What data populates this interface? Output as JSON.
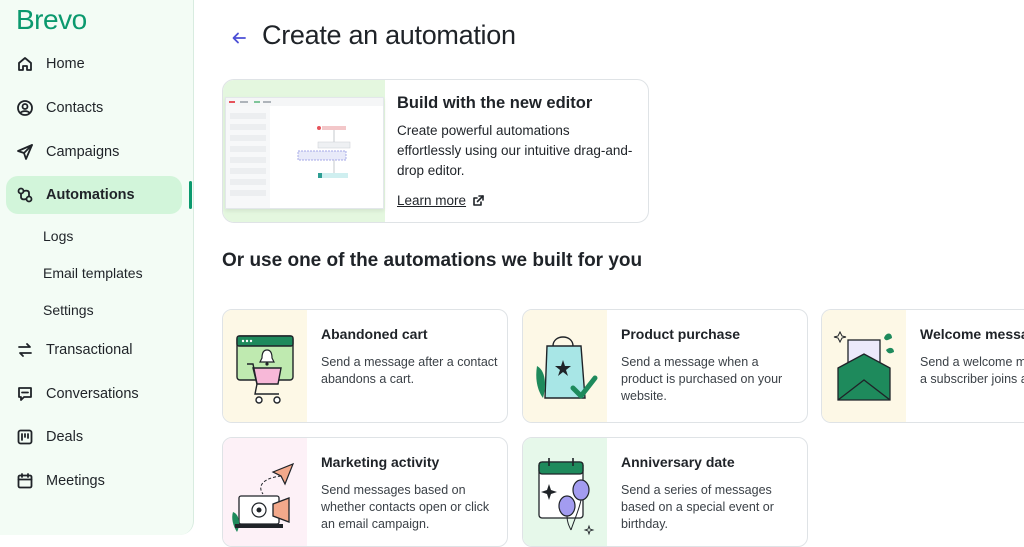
{
  "brand": {
    "logo_text": "Brevo",
    "accent": "#0b996e"
  },
  "sidebar": {
    "items": [
      {
        "label": "Home",
        "icon": "home-icon"
      },
      {
        "label": "Contacts",
        "icon": "contacts-icon"
      },
      {
        "label": "Campaigns",
        "icon": "campaigns-icon"
      },
      {
        "label": "Automations",
        "icon": "automations-icon",
        "active": true
      },
      {
        "label": "Transactional",
        "icon": "transactional-icon"
      },
      {
        "label": "Conversations",
        "icon": "conversations-icon"
      },
      {
        "label": "Deals",
        "icon": "deals-icon"
      },
      {
        "label": "Meetings",
        "icon": "meetings-icon"
      }
    ],
    "sub_items": [
      "Logs",
      "Email templates",
      "Settings"
    ]
  },
  "header": {
    "title": "Create an automation"
  },
  "editor_card": {
    "title": "Build with the new editor",
    "description": "Create powerful automations effortlessly using our intuitive drag-and-drop editor.",
    "link": "Learn more"
  },
  "section_title": "Or use one of the automations we built for you",
  "cards": [
    {
      "title": "Abandoned cart",
      "description": "Send a message after a contact abandons a cart.",
      "bg": "#fdf8e6"
    },
    {
      "title": "Product purchase",
      "description": "Send a message when a product is purchased on your website.",
      "bg": "#fdf8e6"
    },
    {
      "title": "Welcome message",
      "description": "Send a welcome message after a subscriber joins a list.",
      "bg": "#fdf8e6"
    },
    {
      "title": "Marketing activity",
      "description": "Send messages based on whether contacts open or click an email campaign.",
      "bg": "#fdf1f7"
    },
    {
      "title": "Anniversary date",
      "description": "Send a series of messages based on a special event or birthday.",
      "bg": "#e6f8ea"
    }
  ]
}
